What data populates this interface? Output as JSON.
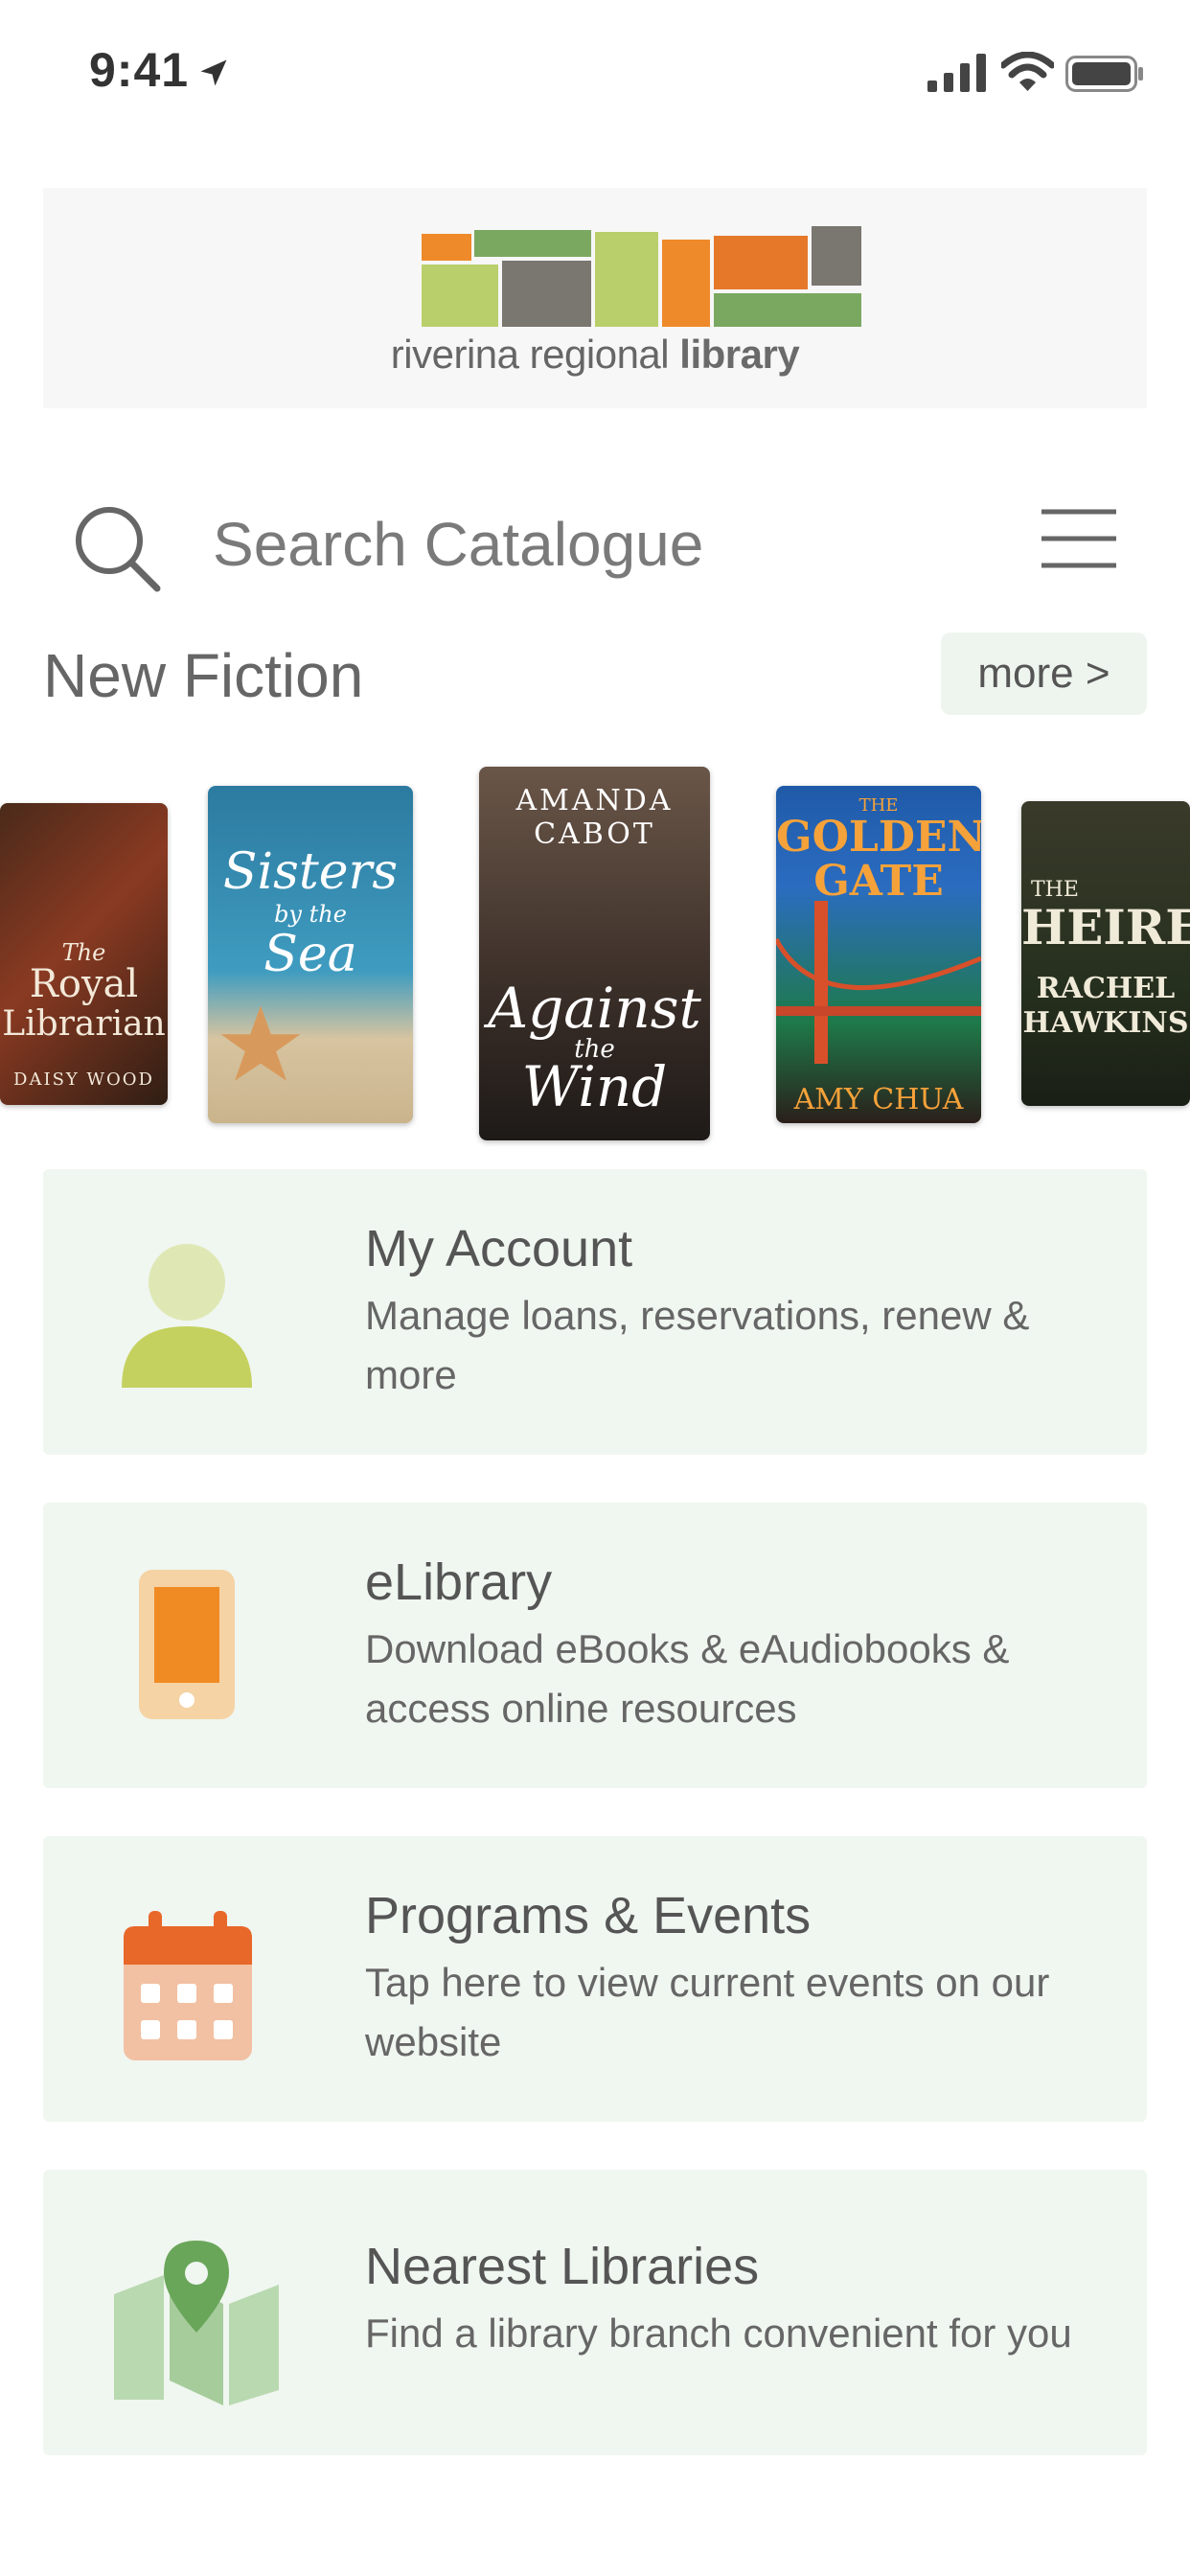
{
  "status_bar": {
    "time": "9:41"
  },
  "logo": {
    "text_regular": "riverina regional ",
    "text_bold": "library"
  },
  "search": {
    "placeholder": "Search Catalogue"
  },
  "new_fiction": {
    "title": "New Fiction",
    "more_label": "more >",
    "books": [
      {
        "title_line1": "The",
        "title_line2": "Royal",
        "title_line3": "Librarian",
        "author": "DAISY WOOD"
      },
      {
        "title_line1": "Sisters",
        "title_line2": "by the",
        "title_line3": "Sea"
      },
      {
        "author": "AMANDA CABOT",
        "title_line1": "Against",
        "title_line2": "the",
        "title_line3": "Wind"
      },
      {
        "title_line1": "THE",
        "title_line2": "GOLDEN",
        "title_line3": "GATE",
        "author": "AMY CHUA"
      },
      {
        "title_line1": "THE",
        "title_line2": "HEIRESS",
        "author_line1": "RACHEL",
        "author_line2": "HAWKINS"
      }
    ]
  },
  "menu": [
    {
      "title": "My Account",
      "desc": "Manage loans, reservations, renew & more",
      "icon": "user-icon"
    },
    {
      "title": "eLibrary",
      "desc": "Download eBooks & eAudiobooks & access online resources",
      "icon": "phone-icon"
    },
    {
      "title": "Programs & Events",
      "desc": "Tap here to view current events on our website",
      "icon": "calendar-icon"
    },
    {
      "title": "Nearest Libraries",
      "desc": "Find a library branch convenient for you",
      "icon": "map-pin-icon"
    }
  ],
  "colors": {
    "card_bg": "#f0f6f0",
    "brand_green": "#b9cf6b",
    "brand_orange": "#ee8a2a",
    "brand_gray": "#7a7670",
    "map_green": "#6aa65a"
  }
}
